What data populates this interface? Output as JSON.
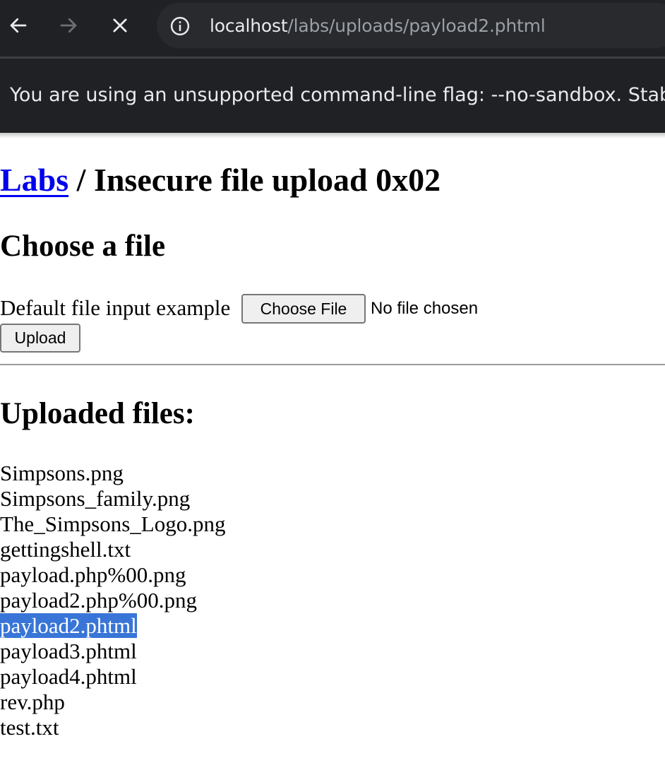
{
  "browser": {
    "url_host": "localhost",
    "url_path": "/labs/uploads/payload2.phtml",
    "infobar_text": "You are using an unsupported command-line flag: --no-sandbox. Stability and security will suffer."
  },
  "header": {
    "breadcrumb_link": "Labs",
    "title_rest": " / Insecure file upload 0x02"
  },
  "upload_form": {
    "heading": "Choose a file",
    "label": "Default file input example",
    "choose_button": "Choose File",
    "no_file_text": "No file chosen",
    "upload_button": "Upload"
  },
  "uploaded": {
    "heading": "Uploaded files:",
    "selected_index": 6,
    "files": [
      "Simpsons.png",
      "Simpsons_family.png",
      "The_Simpsons_Logo.png",
      "gettingshell.txt",
      "payload.php%00.png",
      "payload2.php%00.png",
      "payload2.phtml",
      "payload3.phtml",
      "payload4.phtml",
      "rev.php",
      "test.txt"
    ]
  },
  "colors": {
    "chrome_bg": "#202124",
    "link": "#0000ee",
    "selection": "#3875d7"
  }
}
